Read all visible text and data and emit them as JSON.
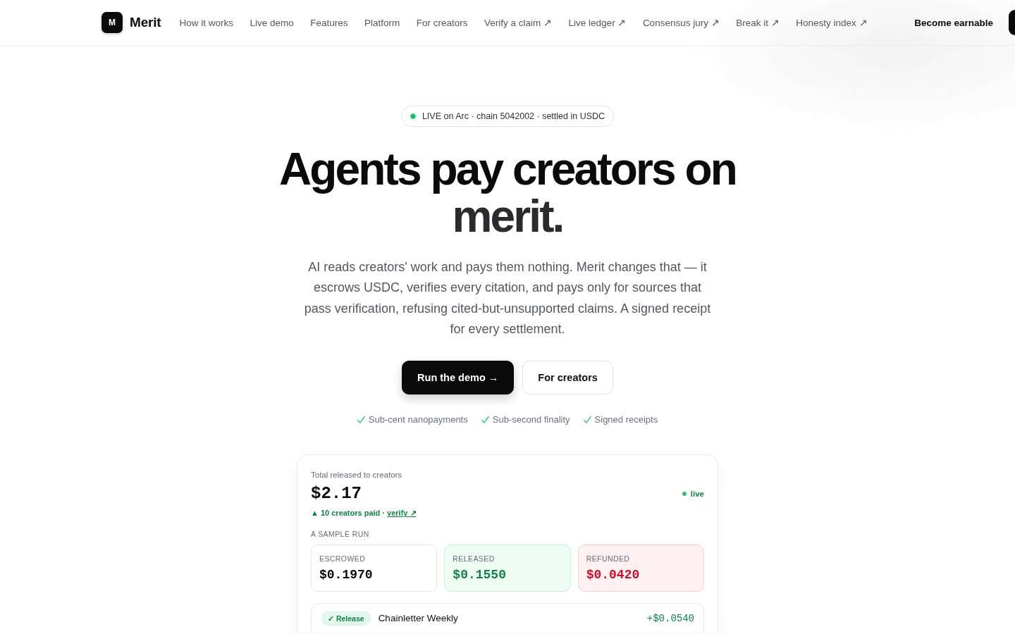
{
  "nav": {
    "logo_mark": "M",
    "brand": "Merit",
    "links": [
      "How it works",
      "Live demo",
      "Features",
      "Platform",
      "For creators",
      "Verify a claim ↗",
      "Live ledger ↗",
      "Consensus jury ↗",
      "Break it ↗",
      "Honesty index ↗"
    ],
    "cta_link": "Become earnable"
  },
  "hero": {
    "badge": "LIVE on Arc · chain 5042002 · settled in USDC",
    "headline": {
      "text": "Agents pay creators on",
      "accent": "merit."
    },
    "lede": "AI reads creators' work and pays them nothing. Merit changes that — it escrows USDC, verifies every citation, and pays only for sources that pass verification, refusing cited-but-unsupported claims. A signed receipt for every settlement.",
    "buttons": [
      {
        "label": "Run the demo →",
        "kind": "primary"
      },
      {
        "label": "For creators",
        "kind": "secondary"
      }
    ],
    "features": [
      "Sub-cent nanopayments",
      "Sub-second finality",
      "Signed receipts"
    ]
  },
  "summary_card": {
    "title": "Total released to creators",
    "total": "$2.17",
    "status": "live",
    "note": "▲ 10 creators paid ·",
    "note_link": "verify ↗",
    "section_label": "A SAMPLE RUN",
    "stats": [
      {
        "label": "ESCROWED",
        "value": "$0.1970",
        "kind": "neutral"
      },
      {
        "label": "RELEASED",
        "value": "$0.1550",
        "kind": "released"
      },
      {
        "label": "REFUNDED",
        "value": "$0.0420",
        "kind": "refunded"
      }
    ],
    "ledger": [
      {
        "kind": "release",
        "badge": "✓ Release",
        "source": "Chainletter Weekly",
        "amount": "+$0.0540"
      }
    ]
  }
}
